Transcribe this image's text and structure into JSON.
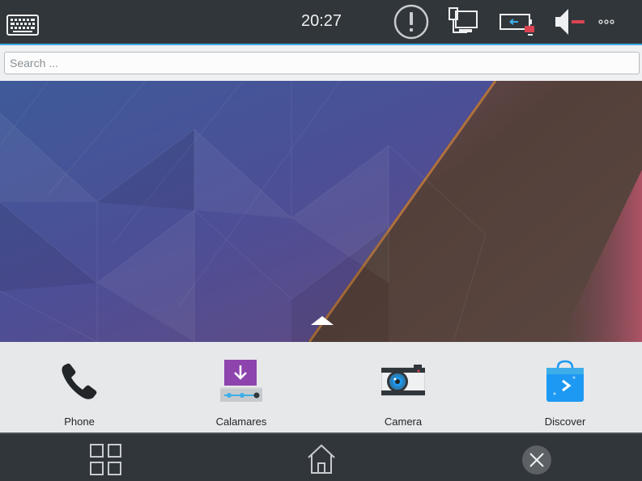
{
  "top_panel": {
    "clock": "20:27",
    "icons": {
      "keyboard": "keyboard-icon",
      "alert": "notifications-alert-icon",
      "network": "network-wired-icon",
      "battery": "battery-missing-icon",
      "volume": "audio-volume-muted-icon",
      "more": "more-icon"
    }
  },
  "search": {
    "placeholder": "Search ...",
    "value": ""
  },
  "favorites": [
    {
      "label": "Phone",
      "icon": "phone-icon"
    },
    {
      "label": "Calamares",
      "icon": "calamares-installer-icon"
    },
    {
      "label": "Camera",
      "icon": "camera-icon"
    },
    {
      "label": "Discover",
      "icon": "discover-store-icon"
    }
  ],
  "bottom_nav": {
    "icons": [
      "app-grid-icon",
      "home-icon",
      "close-icon"
    ]
  },
  "colors": {
    "panel": "#31363b",
    "accent": "#3daee9",
    "dock": "#eff0f1",
    "alert_red": "#da4453"
  }
}
